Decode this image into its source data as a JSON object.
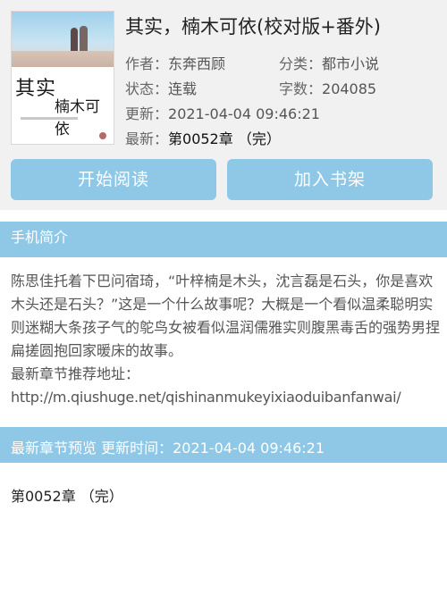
{
  "book": {
    "title": "其实，楠木可依(校对版+番外)",
    "cover": {
      "title_line1": "其实",
      "title_line2": "楠木可依"
    },
    "author_label": "作者：",
    "author": "东奔西顾",
    "category_label": "分类：",
    "category": "都市小说",
    "status_label": "状态：",
    "status": "连载",
    "words_label": "字数：",
    "words": "204085",
    "updated_label": "更新：",
    "updated": "2021-04-04 09:46:21",
    "latest_label": "最新：",
    "latest": "第0052章 （完）"
  },
  "actions": {
    "read": "开始阅读",
    "shelf": "加入书架"
  },
  "intro": {
    "header": "手机简介",
    "text": "陈思佳托着下巴问宿琦，“叶梓楠是木头，沈言磊是石头，你是喜欢木头还是石头？”这是一个什么故事呢？大概是一个看似温柔聪明实则迷糊大条孩子气的鸵鸟女被看似温润儒雅实则腹黑毒舌的强势男捏扁搓圆抱回家暖床的故事。",
    "recommend_label": "最新章节推荐地址：",
    "url": "http://m.qiushuge.net/qishinanmukeyixiaoduibanfanwai/"
  },
  "preview": {
    "header": "最新章节预览 更新时间：2021-04-04 09:46:21",
    "chapters": [
      "第0052章 （完）"
    ]
  },
  "colors": {
    "accent": "#8ec8e6",
    "panel": "#f1f1f1"
  }
}
